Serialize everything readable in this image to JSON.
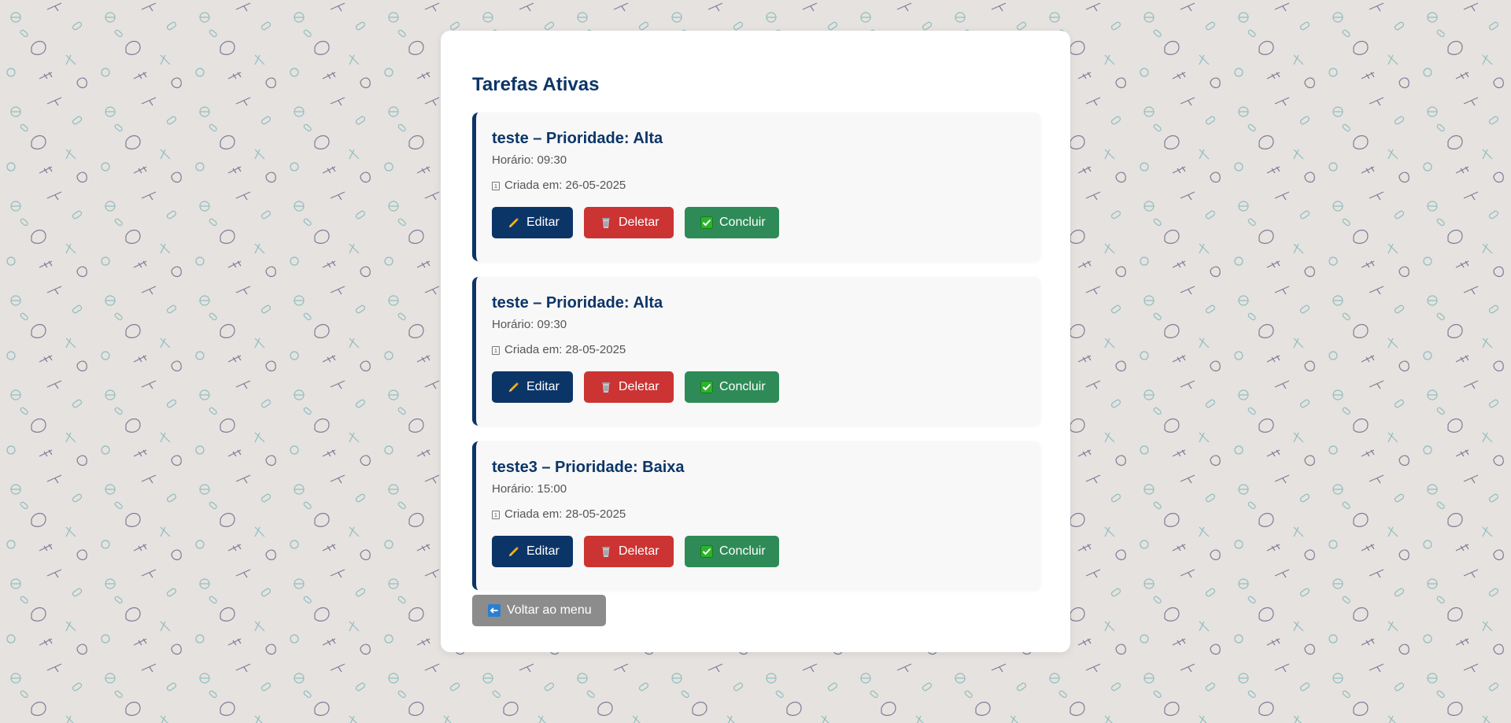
{
  "page": {
    "title": "Tarefas Ativas"
  },
  "tasks": [
    {
      "title": "teste – Prioridade: Alta",
      "time": "Horário: 09:30",
      "created": "Criada em: 26-05-2025"
    },
    {
      "title": "teste – Prioridade: Alta",
      "time": "Horário: 09:30",
      "created": "Criada em: 28-05-2025"
    },
    {
      "title": "teste3 – Prioridade: Baixa",
      "time": "Horário: 15:00",
      "created": "Criada em: 28-05-2025"
    }
  ],
  "actions": {
    "edit_label": "Editar",
    "delete_label": "Deletar",
    "done_label": "Concluir",
    "calendar_glyph": "1"
  },
  "back": {
    "label": "Voltar ao menu"
  },
  "colors": {
    "primary": "#0c3567",
    "delete": "#cc3333",
    "done": "#2e8b57",
    "back": "#8c8c8c",
    "background": "#e6e2df",
    "card": "#f8f8f8"
  },
  "icons": {
    "edit": "pencil-icon",
    "delete": "wastebasket-icon",
    "done": "check-box-icon",
    "back": "left-arrow-icon",
    "created": "calendar-icon"
  }
}
